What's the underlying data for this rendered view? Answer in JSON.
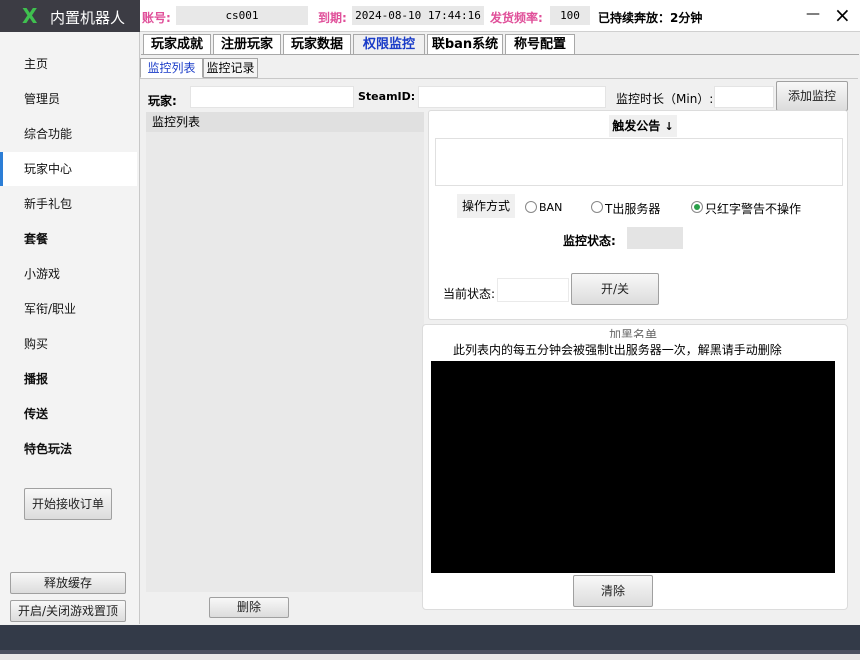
{
  "app": {
    "logo_text": "内置机器人",
    "logo_mark": "X"
  },
  "header": {
    "account_label": "账号:",
    "account_value": "cs001",
    "expiry_label": "到期:",
    "expiry_value": "2024-08-10 17:44:16",
    "freq_label": "发货频率:",
    "freq_value": "100",
    "status_text": "已持续奔放：2分钟",
    "minimize": "—",
    "close": "×"
  },
  "sidebar": {
    "items": [
      {
        "label": "主页"
      },
      {
        "label": "管理员"
      },
      {
        "label": "综合功能"
      },
      {
        "label": "玩家中心"
      },
      {
        "label": "新手礼包"
      },
      {
        "label": "套餐"
      },
      {
        "label": "小游戏"
      },
      {
        "label": "军衔/职业"
      },
      {
        "label": "购买"
      },
      {
        "label": "播报"
      },
      {
        "label": "传送"
      },
      {
        "label": "特色玩法"
      }
    ],
    "order_button": "开始接收订单",
    "release_cache": "释放缓存",
    "toggle_top": "开启/关闭游戏置顶"
  },
  "tabs": [
    "玩家成就",
    "注册玩家",
    "玩家数据",
    "权限监控",
    "联ban系统",
    "称号配置"
  ],
  "subtabs": [
    "监控列表",
    "监控记录"
  ],
  "form": {
    "player_label": "玩家:",
    "steam_label": "SteamID:",
    "duration_label": "监控时长（Min）:",
    "add_button": "添加监控"
  },
  "list": {
    "header": "监控列表",
    "delete_button": "删除"
  },
  "trigger": {
    "title": "触发公告",
    "mode_label": "操作方式",
    "opt_ban": "BAN",
    "opt_kick": "T出服务器",
    "opt_warn": "只红字警告不操作",
    "monitor_status_label": "监控状态:",
    "current_status_label": "当前状态:",
    "toggle_button": "开/关"
  },
  "blacklist": {
    "title": "加黑名单",
    "note": "此列表内的每五分钟会被强制t出服务器一次，解黑请手动删除",
    "clear_button": "清除"
  },
  "colors": {
    "pink": "#e0509a",
    "accent": "#2c7ed6",
    "logo_green": "#3fc04f",
    "dark_bar": "#3c3c44"
  }
}
